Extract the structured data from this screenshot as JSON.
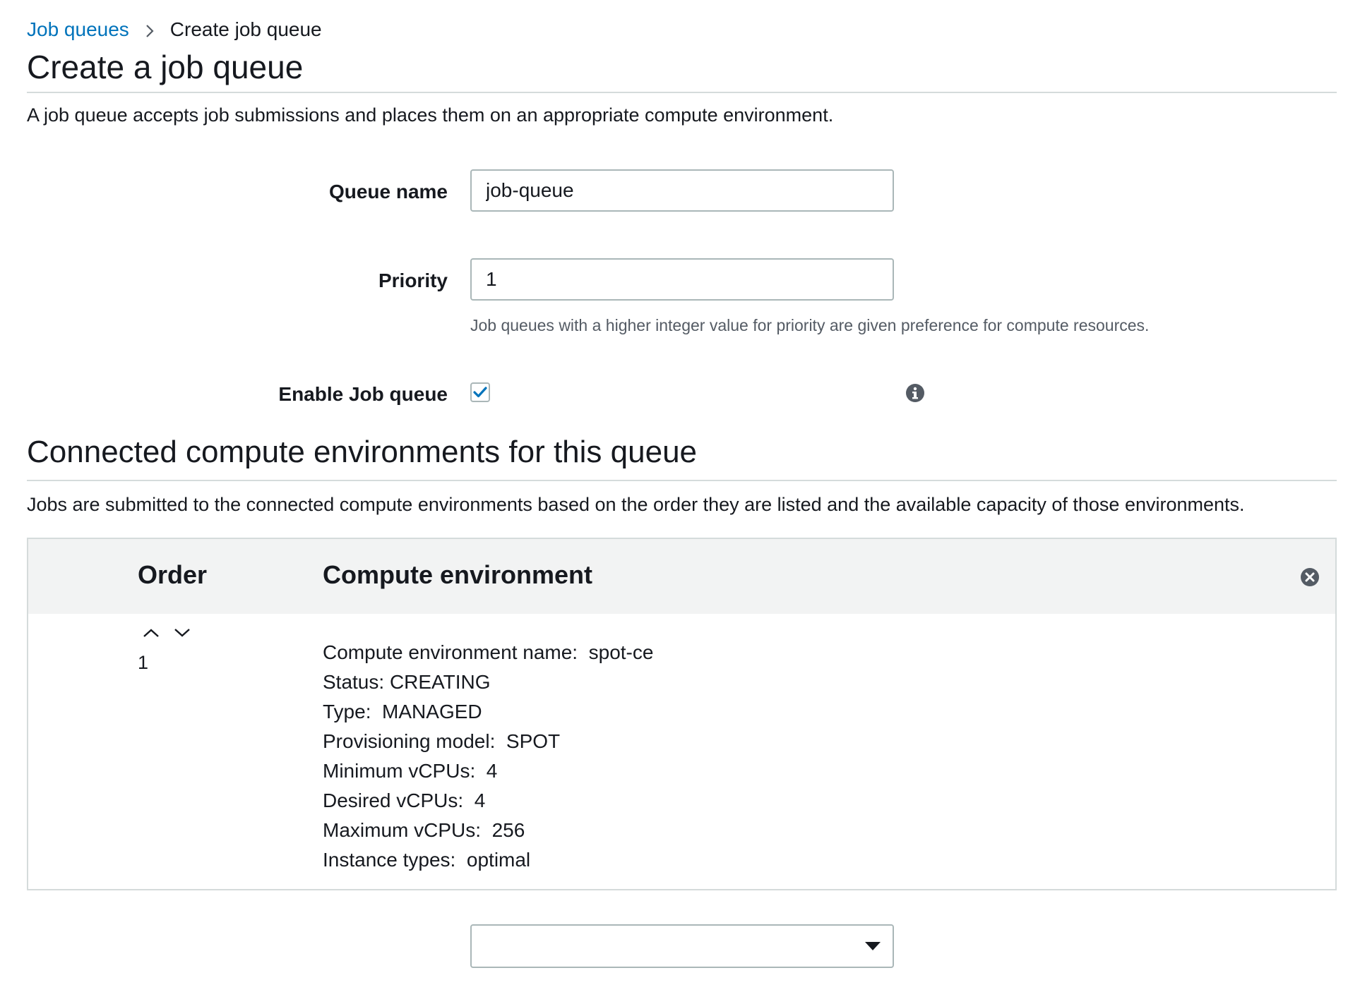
{
  "breadcrumb": {
    "parent": "Job queues",
    "current": "Create job queue"
  },
  "page": {
    "title": "Create a job queue",
    "description": "A job queue accepts job submissions and places them on an appropriate compute environment."
  },
  "form": {
    "queue_name_label": "Queue name",
    "queue_name_value": "job-queue",
    "priority_label": "Priority",
    "priority_value": "1",
    "priority_hint": "Job queues with a higher integer value for priority are given preference for compute resources.",
    "enable_label": "Enable Job queue",
    "enable_checked": true
  },
  "compute_section": {
    "title": "Connected compute environments for this queue",
    "description": "Jobs are submitted to the connected compute environments based on the order they are listed and the available capacity of those environments.",
    "columns": [
      "Order",
      "Compute environment"
    ],
    "rows": [
      {
        "order": "1",
        "details": [
          "Compute environment name:  spot-ce",
          "Status: CREATING",
          "Type:  MANAGED",
          "Provisioning model:  SPOT",
          "Minimum vCPUs:  4",
          "Desired vCPUs:  4",
          "Maximum vCPUs:  256",
          "Instance types:  optimal"
        ]
      }
    ],
    "select_value": ""
  },
  "icons": {
    "breadcrumb_separator": "chevron-right-icon",
    "info": "info-icon",
    "remove": "close-circle-icon",
    "move_up": "chevron-up-icon",
    "move_down": "chevron-down-icon",
    "select_caret": "caret-down-icon"
  },
  "colors": {
    "link": "#0073bb",
    "checkbox_check": "#0073bb",
    "table_header_bg": "#f2f3f3",
    "border": "#aab7b8"
  }
}
